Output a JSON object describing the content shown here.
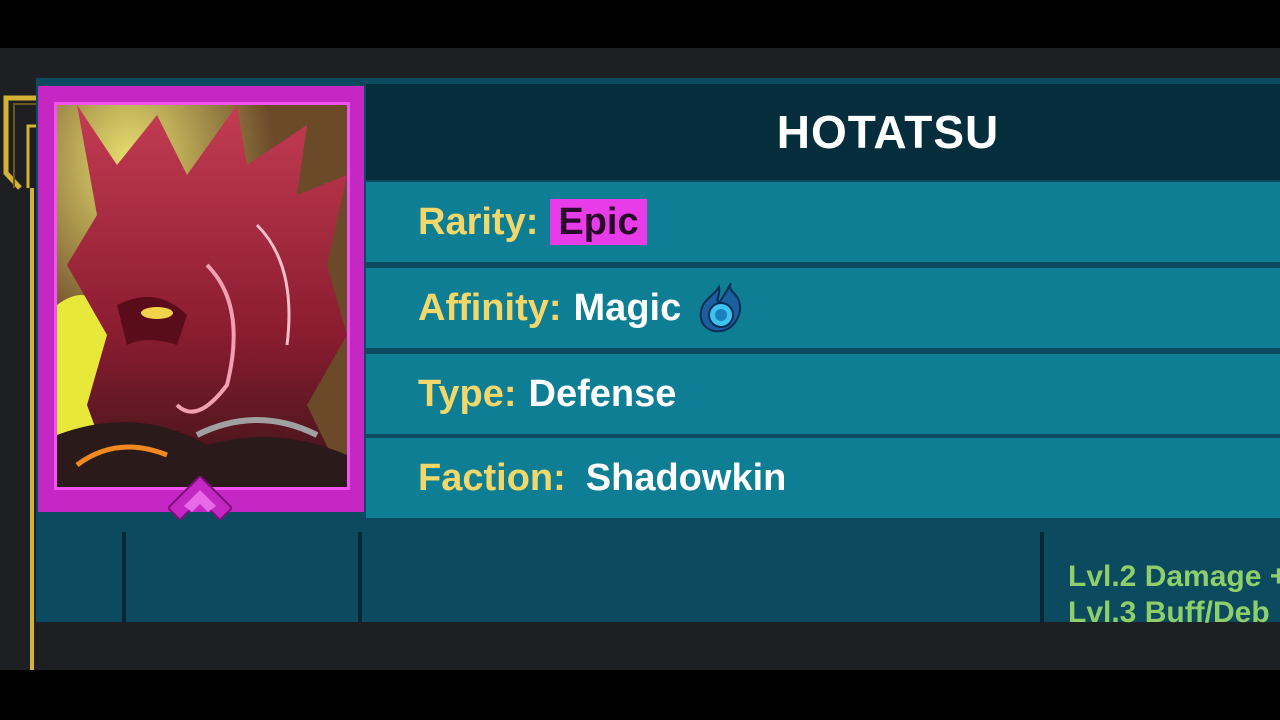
{
  "hero": {
    "name": "HOTATSU",
    "portrait_icon": "demon-hero-portrait",
    "accent_color": "#c527c5"
  },
  "attributes": {
    "rarity": {
      "label": "Rarity:",
      "value": "Epic",
      "color": "#e83ce8"
    },
    "affinity": {
      "label": "Affinity:",
      "value": "Magic",
      "icon": "magic-affinity-icon",
      "color": "#2aa8d8"
    },
    "type": {
      "label": "Type:",
      "value": "Defense"
    },
    "faction": {
      "label": "Faction:",
      "value": "Shadowkin"
    }
  },
  "skills_preview": {
    "lines": [
      "Lvl.2 Damage +",
      "Lvl.3 Buff/Deb"
    ]
  },
  "colors": {
    "label": "#f2d86b",
    "row_bg": "#0e7e94",
    "title_bg": "#052d3c",
    "frame_gold": "#d4b233",
    "level_text": "#8fcf6a"
  }
}
